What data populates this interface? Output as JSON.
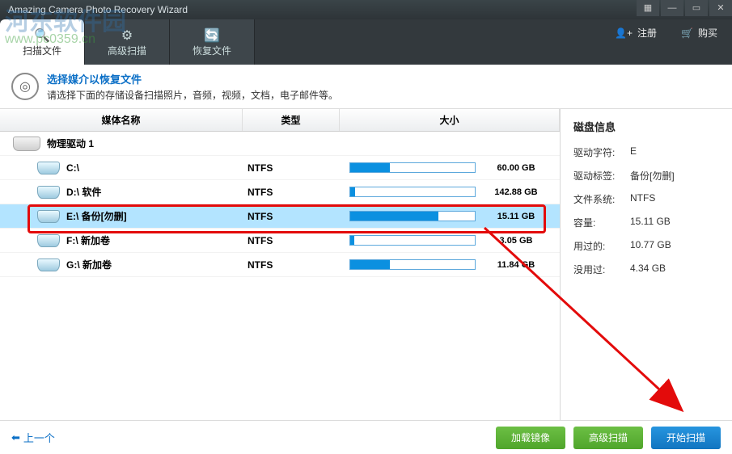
{
  "title": "Amazing Camera Photo Recovery Wizard",
  "watermark": {
    "line1": "河东软件园",
    "line2": "www.pc0359.cn"
  },
  "toolbar": {
    "tabs": [
      {
        "label": "扫描文件",
        "active": true,
        "icon": "🔍"
      },
      {
        "label": "高级扫描",
        "active": false,
        "icon": "⚙"
      },
      {
        "label": "恢复文件",
        "active": false,
        "icon": "🔄"
      }
    ],
    "register": "注册",
    "buy": "购买"
  },
  "banner": {
    "title": "选择媒介以恢复文件",
    "subtitle": "请选择下面的存储设备扫描照片，音频，视频，文档，电子邮件等。"
  },
  "columns": {
    "c1": "媒体名称",
    "c2": "类型",
    "c3": "大小"
  },
  "physical": {
    "label": "物理驱动  1"
  },
  "drives": [
    {
      "name": "C:\\",
      "type": "NTFS",
      "size": "60.00 GB",
      "fill": 32
    },
    {
      "name": "D:\\ 软件",
      "type": "NTFS",
      "size": "142.88 GB",
      "fill": 4
    },
    {
      "name": "E:\\ 备份[勿删]",
      "type": "NTFS",
      "size": "15.11 GB",
      "fill": 71,
      "selected": true
    },
    {
      "name": "F:\\ 新加卷",
      "type": "NTFS",
      "size": "3.05 GB",
      "fill": 3
    },
    {
      "name": "G:\\ 新加卷",
      "type": "NTFS",
      "size": "11.84 GB",
      "fill": 32
    }
  ],
  "info": {
    "heading": "磁盘信息",
    "labels": {
      "letter": "驱动字符:",
      "tag": "驱动标签:",
      "fs": "文件系统:",
      "cap": "容量:",
      "used": "用过的:",
      "free": "没用过:"
    },
    "values": {
      "letter": "E",
      "tag": "备份[勿删]",
      "fs": "NTFS",
      "cap": "15.11 GB",
      "used": "10.77 GB",
      "free": "4.34 GB"
    }
  },
  "footer": {
    "back": "上一个",
    "buttons": {
      "load": "加载镜像",
      "adv": "高级扫描",
      "start": "开始扫描"
    }
  }
}
